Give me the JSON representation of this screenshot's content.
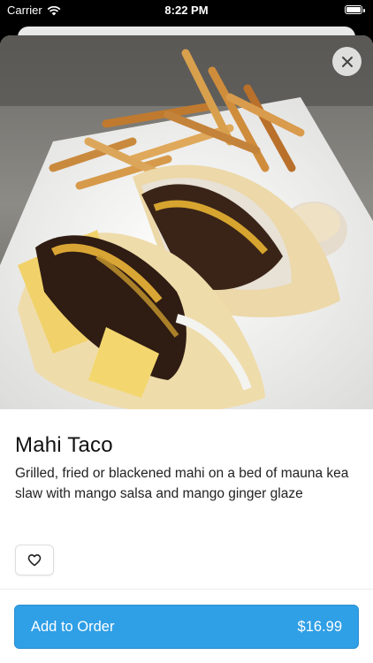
{
  "status_bar": {
    "carrier": "Carrier",
    "time": "8:22 PM"
  },
  "item": {
    "title": "Mahi Taco",
    "description": "Grilled, fried or blackened mahi on a bed of mauna kea slaw with mango salsa and mango ginger glaze",
    "image_alt": "Mahi taco plate"
  },
  "actions": {
    "add_label": "Add to Order",
    "price": "$16.99"
  },
  "colors": {
    "accent": "#2f9fe6"
  },
  "icons": {
    "close": "close-icon",
    "favorite": "heart-icon",
    "wifi": "wifi-icon",
    "battery": "battery-icon"
  }
}
